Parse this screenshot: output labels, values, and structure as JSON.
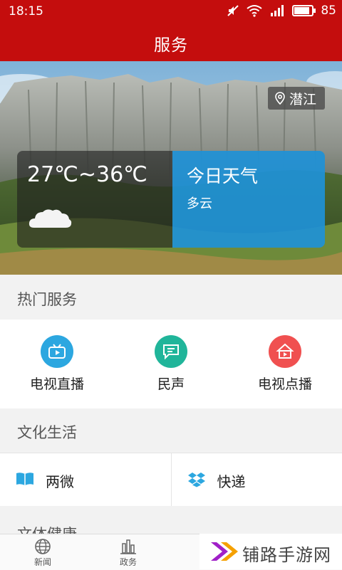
{
  "status": {
    "time": "18:15",
    "battery": "85",
    "battery_level": 0.85
  },
  "header": {
    "title": "服务"
  },
  "hero": {
    "location": "潜江",
    "temperature": "27℃~36℃",
    "today_label": "今日天气",
    "condition": "多云",
    "weather_icon": "cloud-icon"
  },
  "hot_services": {
    "title": "热门服务",
    "items": [
      {
        "label": "电视直播",
        "icon": "tv-play-icon",
        "color": "#2ca7e0"
      },
      {
        "label": "民声",
        "icon": "chat-icon",
        "color": "#20b59a"
      },
      {
        "label": "电视点播",
        "icon": "vod-icon",
        "color": "#f05050"
      }
    ]
  },
  "culture": {
    "title": "文化生活",
    "items": [
      {
        "label": "两微",
        "icon": "book-icon",
        "color": "#2ca7e0"
      },
      {
        "label": "快递",
        "icon": "dropbox-icon",
        "color": "#2ca7e0"
      }
    ],
    "next_section_peek": "文体健康"
  },
  "bottom_nav": {
    "items": [
      {
        "label": "新闻",
        "icon": "globe-icon"
      },
      {
        "label": "政务",
        "icon": "bar-chart-icon"
      }
    ]
  },
  "watermark": {
    "text": "铺路手游网",
    "colors": [
      "#a020c8",
      "#f5a000"
    ]
  }
}
